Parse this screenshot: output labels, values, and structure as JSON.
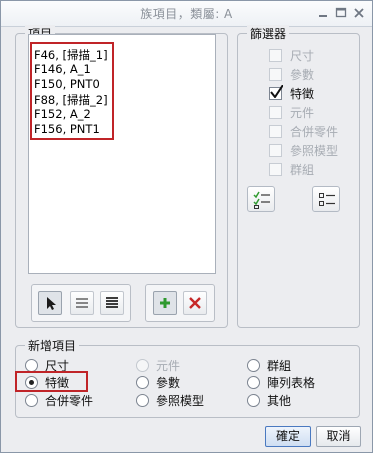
{
  "window": {
    "title": "族項目，類屬: A"
  },
  "items_panel": {
    "label": "項目",
    "entries": [
      "F46, [掃描_1]",
      "F146, A_1",
      "F150, PNT0",
      "F88, [掃描_2]",
      "F152, A_2",
      "F156, PNT1"
    ]
  },
  "filter_panel": {
    "label": "篩選器",
    "options": [
      {
        "label": "尺寸",
        "checked": false,
        "enabled": false
      },
      {
        "label": "參數",
        "checked": false,
        "enabled": false
      },
      {
        "label": "特徵",
        "checked": true,
        "enabled": true
      },
      {
        "label": "元件",
        "checked": false,
        "enabled": false
      },
      {
        "label": "合併零件",
        "checked": false,
        "enabled": false
      },
      {
        "label": "參照模型",
        "checked": false,
        "enabled": false
      },
      {
        "label": "群組",
        "checked": false,
        "enabled": false
      }
    ]
  },
  "add_item": {
    "label": "新增項目",
    "options": [
      {
        "label": "尺寸",
        "selected": false,
        "enabled": true
      },
      {
        "label": "元件",
        "selected": false,
        "enabled": false
      },
      {
        "label": "群組",
        "selected": false,
        "enabled": true
      },
      {
        "label": "特徵",
        "selected": true,
        "enabled": true
      },
      {
        "label": "參數",
        "selected": false,
        "enabled": true
      },
      {
        "label": "陣列表格",
        "selected": false,
        "enabled": true
      },
      {
        "label": "合併零件",
        "selected": false,
        "enabled": true
      },
      {
        "label": "參照模型",
        "selected": false,
        "enabled": true
      },
      {
        "label": "其他",
        "selected": false,
        "enabled": true
      }
    ]
  },
  "buttons": {
    "ok": "確定",
    "cancel": "取消"
  },
  "colors": {
    "highlight": "#c02428",
    "accent": "#4a79c0",
    "add_green": "#2f9a2f",
    "remove_red": "#c62828"
  },
  "icons": [
    "minimize-icon",
    "maximize-icon",
    "close-icon",
    "pointer-icon",
    "list-icon",
    "detail-list-icon",
    "add-icon",
    "remove-icon",
    "select-all-icon",
    "clear-selection-icon"
  ]
}
